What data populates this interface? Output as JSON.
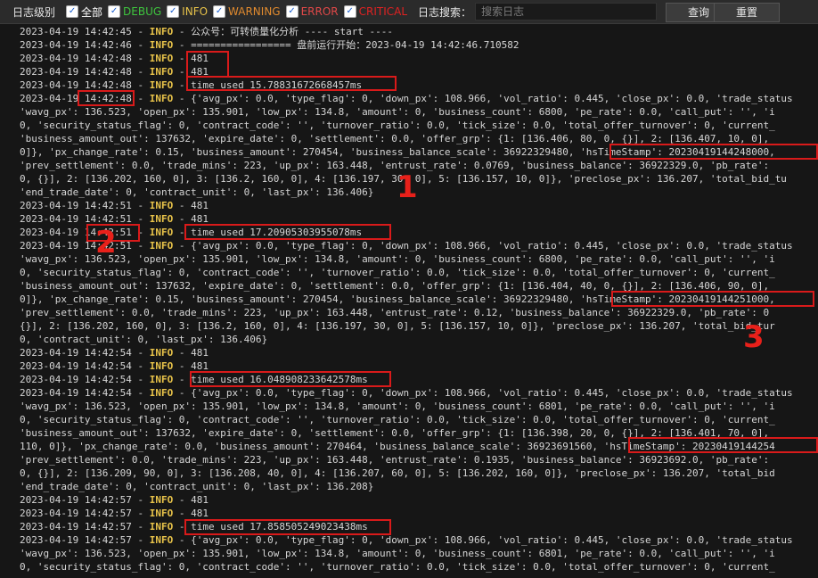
{
  "toolbar": {
    "log_level_label": "日志级别",
    "filters": [
      {
        "label": "全部",
        "checked": true,
        "color": "#ffffff"
      },
      {
        "label": "DEBUG",
        "checked": true,
        "color": "#3ec43e"
      },
      {
        "label": "INFO",
        "checked": true,
        "color": "#e8c34a"
      },
      {
        "label": "WARNING",
        "checked": true,
        "color": "#e08a2e"
      },
      {
        "label": "ERROR",
        "checked": true,
        "color": "#e04848"
      },
      {
        "label": "CRITICAL",
        "checked": true,
        "color": "#e02222"
      }
    ],
    "search_label": "日志搜索：",
    "search_placeholder": "搜索日志",
    "query_button": "查询",
    "reset_button": "重置"
  },
  "log_lines": [
    {
      "ts": "2023-04-19 14:42:45",
      "level": "INFO",
      "msg": " - 公众号：可转债量化分析 ---- start ----"
    },
    {
      "ts": "2023-04-19 14:42:46",
      "level": "INFO",
      "msg": " - ================= 盘前运行开始：2023-04-19 14:42:46.710582"
    },
    {
      "ts": "2023-04-19 14:42:48",
      "level": "INFO",
      "msg": " - 481"
    },
    {
      "ts": "2023-04-19 14:42:48",
      "level": "INFO",
      "msg": " - 481"
    },
    {
      "ts": "2023-04-19 14:42:48",
      "level": "INFO",
      "msg": " - time used 15.78831672668457ms"
    },
    {
      "ts": "2023-04-19 14:42:48",
      "level": "INFO",
      "msg": " - {'avg_px': 0.0, 'type_flag': 0, 'down_px': 108.966, 'vol_ratio': 0.445, 'close_px': 0.0, 'trade_status"
    },
    {
      "ts": "",
      "level": "",
      "msg": "'wavg_px': 136.523, 'open_px': 135.901, 'low_px': 134.8, 'amount': 0, 'business_count': 6800, 'pe_rate': 0.0, 'call_put': '', 'i"
    },
    {
      "ts": "",
      "level": "",
      "msg": "0, 'security_status_flag': 0, 'contract_code': '', 'turnover_ratio': 0.0, 'tick_size': 0.0, 'total_offer_turnover': 0, 'current_"
    },
    {
      "ts": "",
      "level": "",
      "msg": "'business_amount_out': 137632, 'expire_date': 0, 'settlement': 0.0, 'offer_grp': {1: [136.406, 80, 0, {}], 2: [136.407, 10, 0],"
    },
    {
      "ts": "",
      "level": "",
      "msg": "0]}, 'px_change_rate': 0.15, 'business_amount': 270454, 'business_balance_scale': 36922329480, 'hsTimeStamp': 20230419144248000,"
    },
    {
      "ts": "",
      "level": "",
      "msg": "'prev_settlement': 0.0, 'trade_mins': 223, 'up_px': 163.448, 'entrust_rate': 0.0769, 'business_balance': 36922329.0, 'pb_rate':"
    },
    {
      "ts": "",
      "level": "",
      "msg": "0, {}], 2: [136.202, 160, 0], 3: [136.2, 160, 0], 4: [136.197, 30, 0], 5: [136.157, 10, 0]}, 'preclose_px': 136.207, 'total_bid_tu"
    },
    {
      "ts": "",
      "level": "",
      "msg": "'end_trade_date': 0, 'contract_unit': 0, 'last_px': 136.406}"
    },
    {
      "ts": "2023-04-19 14:42:51",
      "level": "INFO",
      "msg": " - 481"
    },
    {
      "ts": "2023-04-19 14:42:51",
      "level": "INFO",
      "msg": " - 481"
    },
    {
      "ts": "2023-04-19 14:42:51",
      "level": "INFO",
      "msg": " - time used 17.20905303955078ms"
    },
    {
      "ts": "2023-04-19 14:42:51",
      "level": "INFO",
      "msg": " - {'avg_px': 0.0, 'type_flag': 0, 'down_px': 108.966, 'vol_ratio': 0.445, 'close_px': 0.0, 'trade_status"
    },
    {
      "ts": "",
      "level": "",
      "msg": "'wavg_px': 136.523, 'open_px': 135.901, 'low_px': 134.8, 'amount': 0, 'business_count': 6800, 'pe_rate': 0.0, 'call_put': '', 'i"
    },
    {
      "ts": "",
      "level": "",
      "msg": "0, 'security_status_flag': 0, 'contract_code': '', 'turnover_ratio': 0.0, 'tick_size': 0.0, 'total_offer_turnover': 0, 'current_"
    },
    {
      "ts": "",
      "level": "",
      "msg": "'business_amount_out': 137632, 'expire_date': 0, 'settlement': 0.0, 'offer_grp': {1: [136.404, 40, 0, {}], 2: [136.406, 90, 0],"
    },
    {
      "ts": "",
      "level": "",
      "msg": "0]}, 'px_change_rate': 0.15, 'business_amount': 270454, 'business_balance_scale': 36922329480, 'hsTimeStamp': 20230419144251000,"
    },
    {
      "ts": "",
      "level": "",
      "msg": "'prev_settlement': 0.0, 'trade_mins': 223, 'up_px': 163.448, 'entrust_rate': 0.12, 'business_balance': 36922329.0, 'pb_rate': 0"
    },
    {
      "ts": "",
      "level": "",
      "msg": "{}], 2: [136.202, 160, 0], 3: [136.2, 160, 0], 4: [136.197, 30, 0], 5: [136.157, 10, 0]}, 'preclose_px': 136.207, 'total_bid_tur"
    },
    {
      "ts": "",
      "level": "",
      "msg": "0, 'contract_unit': 0, 'last_px': 136.406}"
    },
    {
      "ts": "2023-04-19 14:42:54",
      "level": "INFO",
      "msg": " - 481"
    },
    {
      "ts": "2023-04-19 14:42:54",
      "level": "INFO",
      "msg": " - 481"
    },
    {
      "ts": "2023-04-19 14:42:54",
      "level": "INFO",
      "msg": " - time used 16.048908233642578ms"
    },
    {
      "ts": "2023-04-19 14:42:54",
      "level": "INFO",
      "msg": " - {'avg_px': 0.0, 'type_flag': 0, 'down_px': 108.966, 'vol_ratio': 0.445, 'close_px': 0.0, 'trade_status"
    },
    {
      "ts": "",
      "level": "",
      "msg": "'wavg_px': 136.523, 'open_px': 135.901, 'low_px': 134.8, 'amount': 0, 'business_count': 6801, 'pe_rate': 0.0, 'call_put': '', 'i"
    },
    {
      "ts": "",
      "level": "",
      "msg": "0, 'security_status_flag': 0, 'contract_code': '', 'turnover_ratio': 0.0, 'tick_size': 0.0, 'total_offer_turnover': 0, 'current_"
    },
    {
      "ts": "",
      "level": "",
      "msg": "'business_amount_out': 137632, 'expire_date': 0, 'settlement': 0.0, 'offer_grp': {1: [136.398, 20, 0, {}], 2: [136.401, 70, 0],"
    },
    {
      "ts": "",
      "level": "",
      "msg": "110, 0]}, 'px_change_rate': 0.0, 'business_amount': 270464, 'business_balance_scale': 36923691560, 'hsTimeStamp': 20230419144254"
    },
    {
      "ts": "",
      "level": "",
      "msg": "'prev_settlement': 0.0, 'trade_mins': 223, 'up_px': 163.448, 'entrust_rate': 0.1935, 'business_balance': 36923692.0, 'pb_rate':"
    },
    {
      "ts": "",
      "level": "",
      "msg": "0, {}], 2: [136.209, 90, 0], 3: [136.208, 40, 0], 4: [136.207, 60, 0], 5: [136.202, 160, 0]}, 'preclose_px': 136.207, 'total_bid"
    },
    {
      "ts": "",
      "level": "",
      "msg": "'end_trade_date': 0, 'contract_unit': 0, 'last_px': 136.208}"
    },
    {
      "ts": "2023-04-19 14:42:57",
      "level": "INFO",
      "msg": " - 481"
    },
    {
      "ts": "2023-04-19 14:42:57",
      "level": "INFO",
      "msg": " - 481"
    },
    {
      "ts": "2023-04-19 14:42:57",
      "level": "INFO",
      "msg": " - time used 17.858505249023438ms"
    },
    {
      "ts": "2023-04-19 14:42:57",
      "level": "INFO",
      "msg": " - {'avg_px': 0.0, 'type_flag': 0, 'down_px': 108.966, 'vol_ratio': 0.445, 'close_px': 0.0, 'trade_status"
    },
    {
      "ts": "",
      "level": "",
      "msg": "'wavg_px': 136.523, 'open_px': 135.901, 'low_px': 134.8, 'amount': 0, 'business_count': 6801, 'pe_rate': 0.0, 'call_put': '', 'i"
    },
    {
      "ts": "",
      "level": "",
      "msg": "0, 'security_status_flag': 0, 'contract_code': '', 'turnover_ratio': 0.0, 'tick_size': 0.0, 'total_offer_turnover': 0, 'current_"
    }
  ],
  "annotations": [
    {
      "label": "1"
    },
    {
      "label": "2"
    },
    {
      "label": "3"
    }
  ],
  "highlight_color": "#d91a1a"
}
